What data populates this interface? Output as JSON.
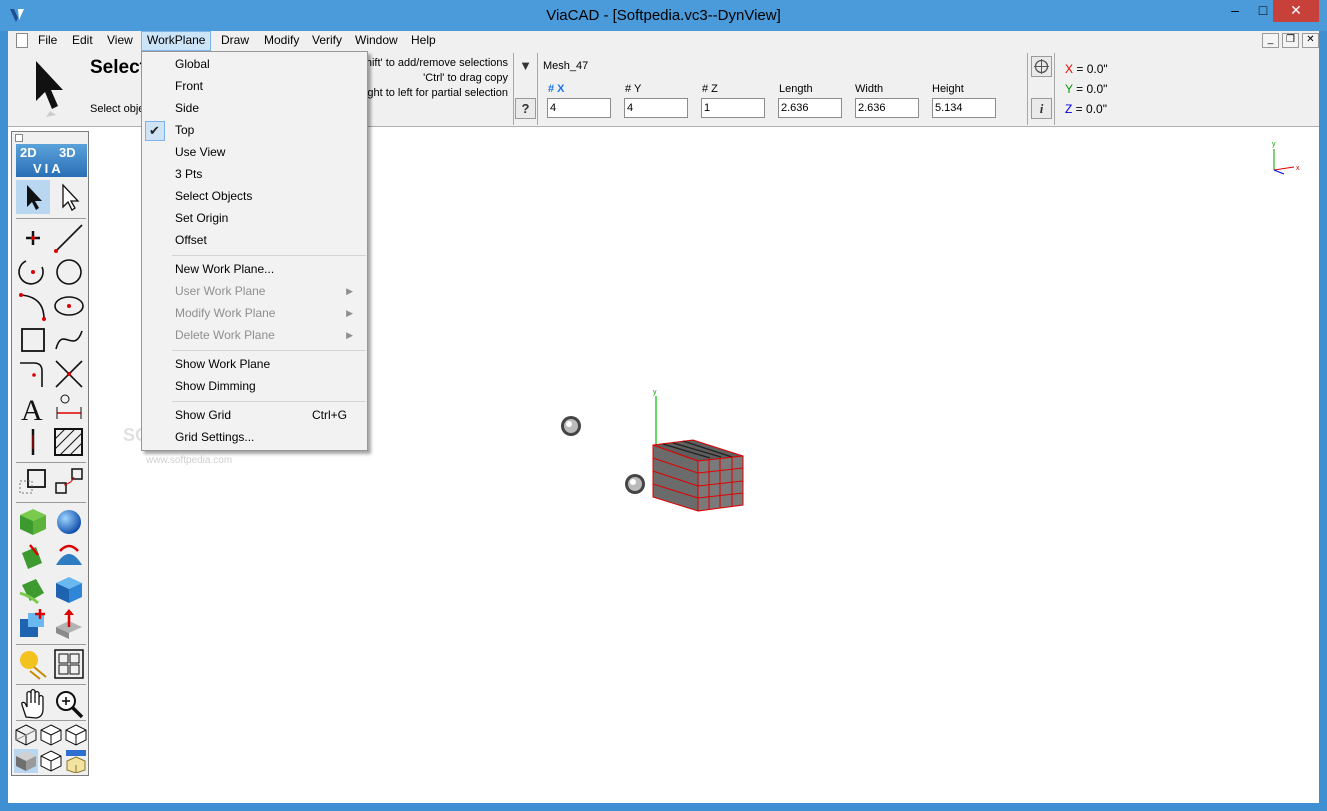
{
  "window": {
    "title": "ViaCAD - [Softpedia.vc3--DynView]",
    "minimize_glyph": "–",
    "maximize_glyph": "□",
    "close_glyph": "✕"
  },
  "menubar": {
    "items": [
      "File",
      "Edit",
      "View",
      "WorkPlane",
      "Draw",
      "Modify",
      "Verify",
      "Window",
      "Help"
    ],
    "active": "WorkPlane"
  },
  "toolbar": {
    "tool_name": "Select",
    "tool_prompt": "Select objects",
    "hints": [
      "'Shift' to add/remove selections",
      "'Ctrl' to drag copy",
      "right to left for partial selection"
    ],
    "help_glyph": "?",
    "dropdown_glyph": "▼",
    "info_glyph": "i",
    "object_name": "Mesh_47",
    "fields": [
      {
        "label": "# X",
        "value": "4"
      },
      {
        "label": "# Y",
        "value": "4"
      },
      {
        "label": "# Z",
        "value": "1"
      },
      {
        "label": "Length",
        "value": "2.636"
      },
      {
        "label": "Width",
        "value": "2.636"
      },
      {
        "label": "Height",
        "value": "5.134"
      }
    ],
    "coords": {
      "x_label": "X",
      "x_value": " = 0.0\"",
      "y_label": "Y",
      "y_value": " = 0.0\"",
      "z_label": "Z",
      "z_value": " = 0.0\""
    }
  },
  "left_toolbar": {
    "logo_2d": "2D",
    "logo_3d": "3D",
    "logo_via": "VIA"
  },
  "workplane_menu": {
    "items": [
      {
        "label": "Global"
      },
      {
        "label": "Front"
      },
      {
        "label": "Side"
      },
      {
        "label": "Top",
        "checked": true
      },
      {
        "label": "Use View"
      },
      {
        "label": "3 Pts"
      },
      {
        "label": "Select Objects"
      },
      {
        "label": "Set Origin"
      },
      {
        "label": "Offset"
      },
      {
        "label": "New Work Plane..."
      },
      {
        "label": "User Work Plane",
        "disabled": true,
        "submenu": true
      },
      {
        "label": "Modify Work Plane",
        "disabled": true,
        "submenu": true
      },
      {
        "label": "Delete Work Plane",
        "disabled": true,
        "submenu": true
      },
      {
        "label": "Show Work Plane"
      },
      {
        "label": "Show Dimming"
      },
      {
        "label": "Show Grid",
        "shortcut": "Ctrl+G"
      },
      {
        "label": "Grid Settings..."
      }
    ],
    "check_glyph": "✔",
    "submenu_glyph": "▶"
  },
  "viewport": {
    "axis_y": "y",
    "axis_x": "x",
    "triad_y": "y",
    "triad_x": "x",
    "watermark": "SOFTPEDIA",
    "watermark_url": "www.softpedia.com"
  },
  "colors": {
    "accent": "#1a73e8",
    "x_axis": "#e00000",
    "y_axis": "#00a000",
    "z_axis": "#0000e0",
    "mesh_edge": "#e00000"
  }
}
